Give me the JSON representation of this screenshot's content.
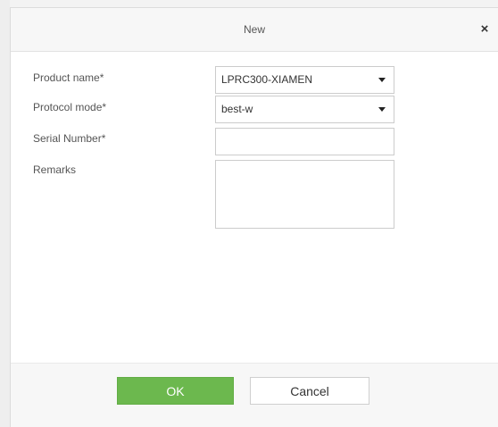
{
  "dialog": {
    "title": "New",
    "close_symbol": "×",
    "close_icon": "close-icon"
  },
  "form": {
    "product_name": {
      "label": "Product name*",
      "value": "LPRC300-XIAMEN",
      "caret_icon": "chevron-down-icon"
    },
    "protocol_mode": {
      "label": "Protocol mode*",
      "value": "best-w",
      "caret_icon": "chevron-down-icon"
    },
    "serial_number": {
      "label": "Serial Number*",
      "value": ""
    },
    "remarks": {
      "label": "Remarks",
      "value": ""
    }
  },
  "footer": {
    "ok_label": "OK",
    "cancel_label": "Cancel"
  },
  "colors": {
    "ok_button": "#6cb84e",
    "title_bar": "#f7f7f7",
    "footer": "#f7f7f7"
  }
}
